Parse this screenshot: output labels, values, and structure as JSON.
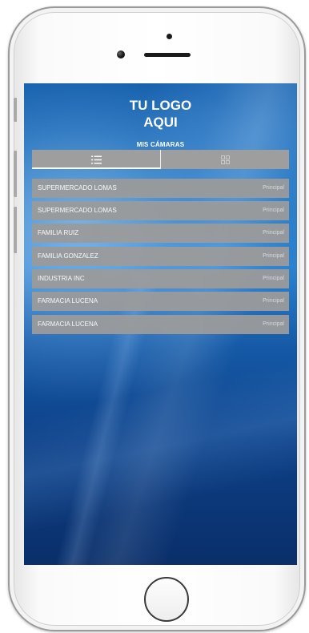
{
  "header": {
    "logo_line1": "TU LOGO",
    "logo_line2": "AQUI",
    "title": "MIS CÁMARAS"
  },
  "tabs": {
    "list_icon": "list-icon",
    "grid_icon": "grid-icon",
    "active": "list"
  },
  "cameras": [
    {
      "name": "SUPERMERCADO LOMAS",
      "group": "Principal"
    },
    {
      "name": "SUPERMERCADO LOMAS",
      "group": "Principal"
    },
    {
      "name": "FAMILIA RUIZ",
      "group": "Principal"
    },
    {
      "name": "FAMILIA GONZALEZ",
      "group": "Principal"
    },
    {
      "name": "INDUSTRIA INC",
      "group": "Principal"
    },
    {
      "name": "FARMACIA LUCENA",
      "group": "Principal"
    },
    {
      "name": "FARMACIA LUCENA",
      "group": "Principal"
    }
  ],
  "colors": {
    "background_blue": "#1a6fbd",
    "row_gray": "#9b9b9b",
    "text_white": "#ffffff"
  }
}
